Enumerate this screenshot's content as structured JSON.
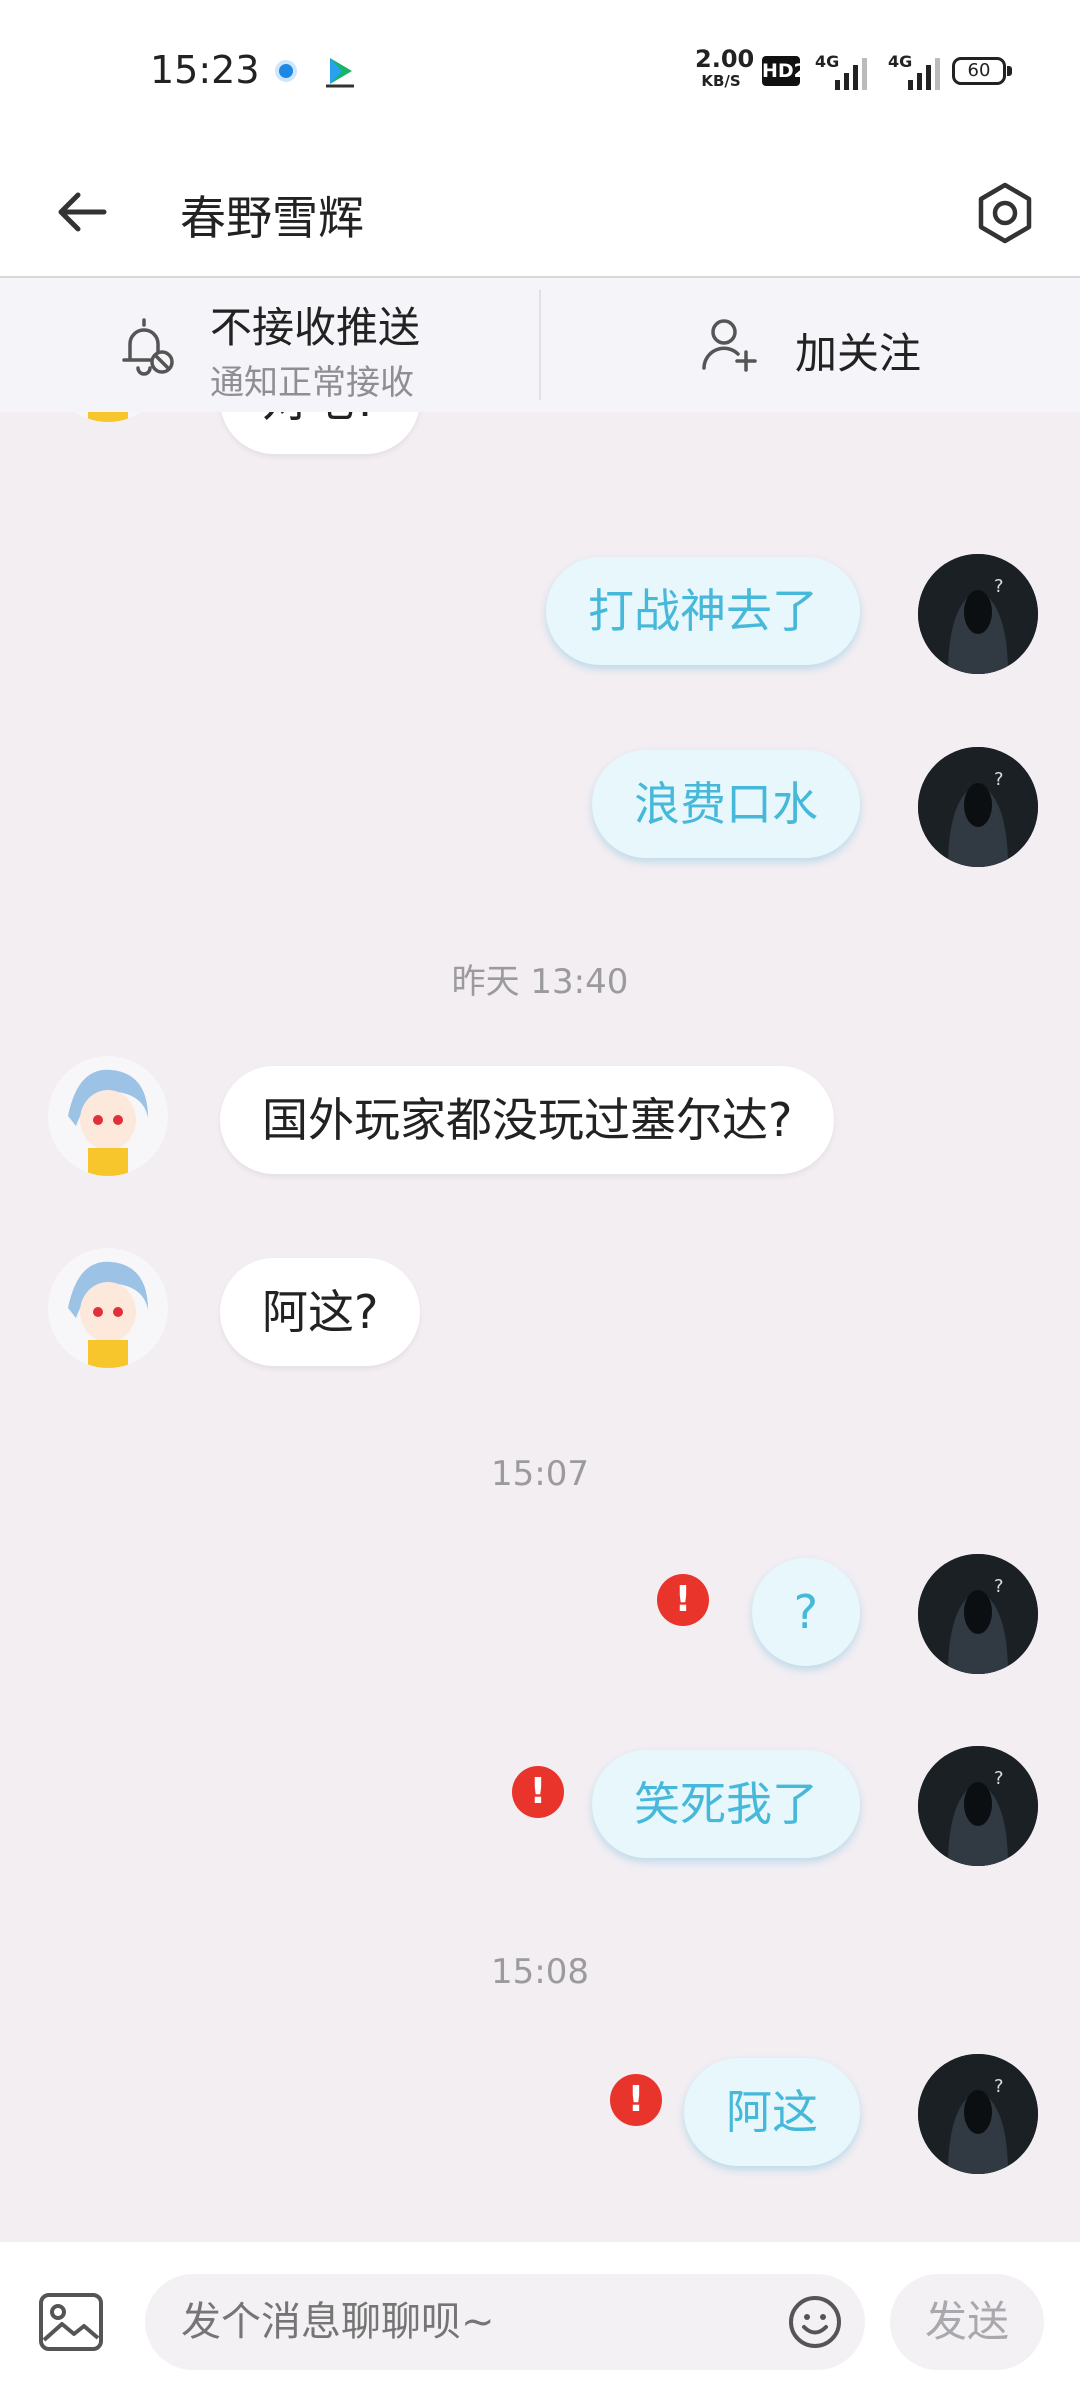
{
  "status_bar": {
    "time": "15:23",
    "net_speed_value": "2.00",
    "net_speed_unit": "KB/S",
    "hd_badge": "HD2",
    "signal_1": "4G",
    "signal_2": "4G",
    "battery": "60"
  },
  "header": {
    "title": "春野雪辉",
    "back_icon": "back-arrow-icon",
    "settings_icon": "settings-icon"
  },
  "notify_bar": {
    "push_main": "不接收推送",
    "push_sub": "通知正常接收",
    "follow_label": "加关注"
  },
  "messages": [
    {
      "side": "in",
      "text": "对吧?"
    },
    {
      "side": "out",
      "text": "打战神去了"
    },
    {
      "side": "out",
      "text": "浪费口水"
    },
    {
      "time": "昨天 13:40"
    },
    {
      "side": "in",
      "text": "国外玩家都没玩过塞尔达?"
    },
    {
      "side": "in",
      "text": "阿这?"
    },
    {
      "time": "15:07"
    },
    {
      "side": "out",
      "text": "?",
      "failed": true
    },
    {
      "side": "out",
      "text": "笑死我了",
      "failed": true
    },
    {
      "time": "15:08"
    },
    {
      "side": "out",
      "text": "阿这",
      "failed": true
    }
  ],
  "error_mark": "!",
  "input_bar": {
    "placeholder": "发个消息聊聊呗~",
    "send_label": "发送"
  },
  "colors": {
    "outgoing_bubble": "#e7f7fc",
    "outgoing_text": "#46b8d9",
    "error_red": "#e8342b",
    "chat_background": "#f3eef2"
  }
}
